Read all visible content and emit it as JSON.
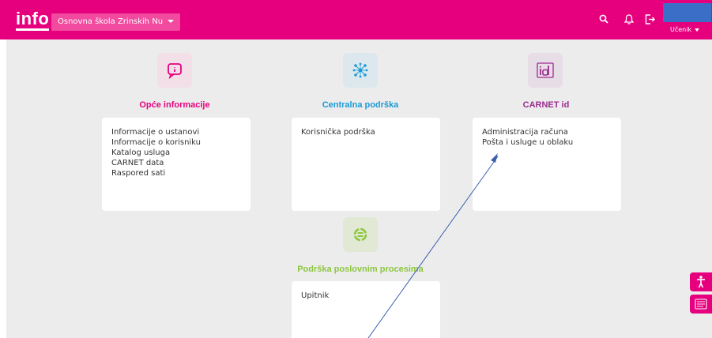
{
  "header": {
    "logo": "info",
    "school": "Osnovna škola Zrinskih Nu",
    "user_role": "Učenik",
    "icons": [
      "search-icon",
      "bell-icon",
      "logout-icon"
    ]
  },
  "sections": [
    {
      "title": "Opće informacije",
      "icon": "info-chat-icon",
      "color": "#e6007e",
      "links": [
        "Informacije o ustanovi",
        "Informacije o korisniku",
        "Katalog usluga",
        "CARNET data",
        "Raspored sati"
      ]
    },
    {
      "title": "Centralna podrška",
      "icon": "network-icon",
      "color": "#1a9bd7",
      "links": [
        "Korisnička podrška"
      ]
    },
    {
      "title": "CARNET id",
      "icon": "id-icon",
      "color": "#9b2c8f",
      "links": [
        "Administracija računa",
        "Pošta i usluge u oblaku"
      ]
    },
    {
      "title": "Podrška poslovnim procesima",
      "icon": "process-icon",
      "color": "#8dc63f",
      "links": [
        "Upitnik"
      ]
    }
  ],
  "side_buttons": [
    "accessibility-icon",
    "dyslexia-icon"
  ],
  "colors": {
    "brand": "#e6007e",
    "background": "#ececec"
  }
}
